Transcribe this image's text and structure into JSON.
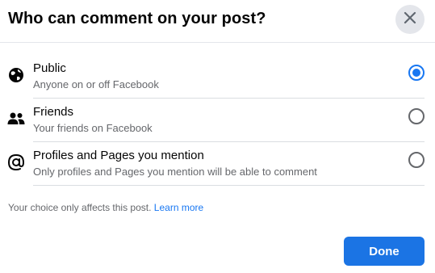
{
  "dialog": {
    "title": "Who can comment on your post?",
    "close_icon": "close-icon"
  },
  "options": [
    {
      "icon": "globe-icon",
      "label": "Public",
      "description": "Anyone on or off Facebook",
      "selected": true
    },
    {
      "icon": "friends-icon",
      "label": "Friends",
      "description": "Your friends on Facebook",
      "selected": false
    },
    {
      "icon": "at-sign-icon",
      "label": "Profiles and Pages you mention",
      "description": "Only profiles and Pages you mention will be able to comment",
      "selected": false
    }
  ],
  "footer": {
    "note": "Your choice only affects this post.",
    "link": "Learn more",
    "done_label": "Done"
  },
  "colors": {
    "accent": "#1877f2",
    "button": "#1b74e4",
    "secondary_text": "#65676b"
  }
}
